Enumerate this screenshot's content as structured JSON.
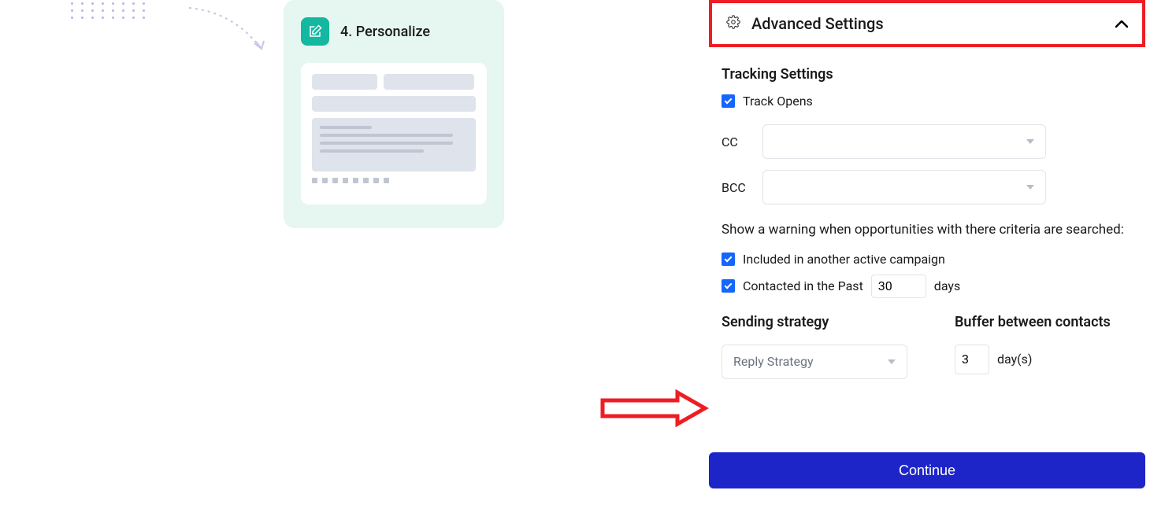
{
  "personalize_card": {
    "title": "4. Personalize",
    "icon": "edit-icon"
  },
  "advanced_settings": {
    "title": "Advanced Settings",
    "expanded": true
  },
  "tracking": {
    "heading": "Tracking Settings",
    "track_opens_label": "Track Opens",
    "track_opens_checked": true,
    "cc_label": "CC",
    "cc_value": "",
    "bcc_label": "BCC",
    "bcc_value": ""
  },
  "warning": {
    "text": "Show a warning when opportunities with there criteria are searched:",
    "included_label": "Included in another active campaign",
    "included_checked": true,
    "contacted_prefix": "Contacted in the Past",
    "contacted_days_value": "30",
    "contacted_suffix": "days",
    "contacted_checked": true
  },
  "sending_strategy": {
    "heading": "Sending strategy",
    "selected": "Reply Strategy"
  },
  "buffer": {
    "heading": "Buffer between contacts",
    "value": "3",
    "unit": "day(s)"
  },
  "continue_label": "Continue",
  "colors": {
    "teal": "#14b8a0",
    "blue_check": "#1565ff",
    "highlight_red": "#ee1d24",
    "button_blue": "#1e25c8"
  }
}
